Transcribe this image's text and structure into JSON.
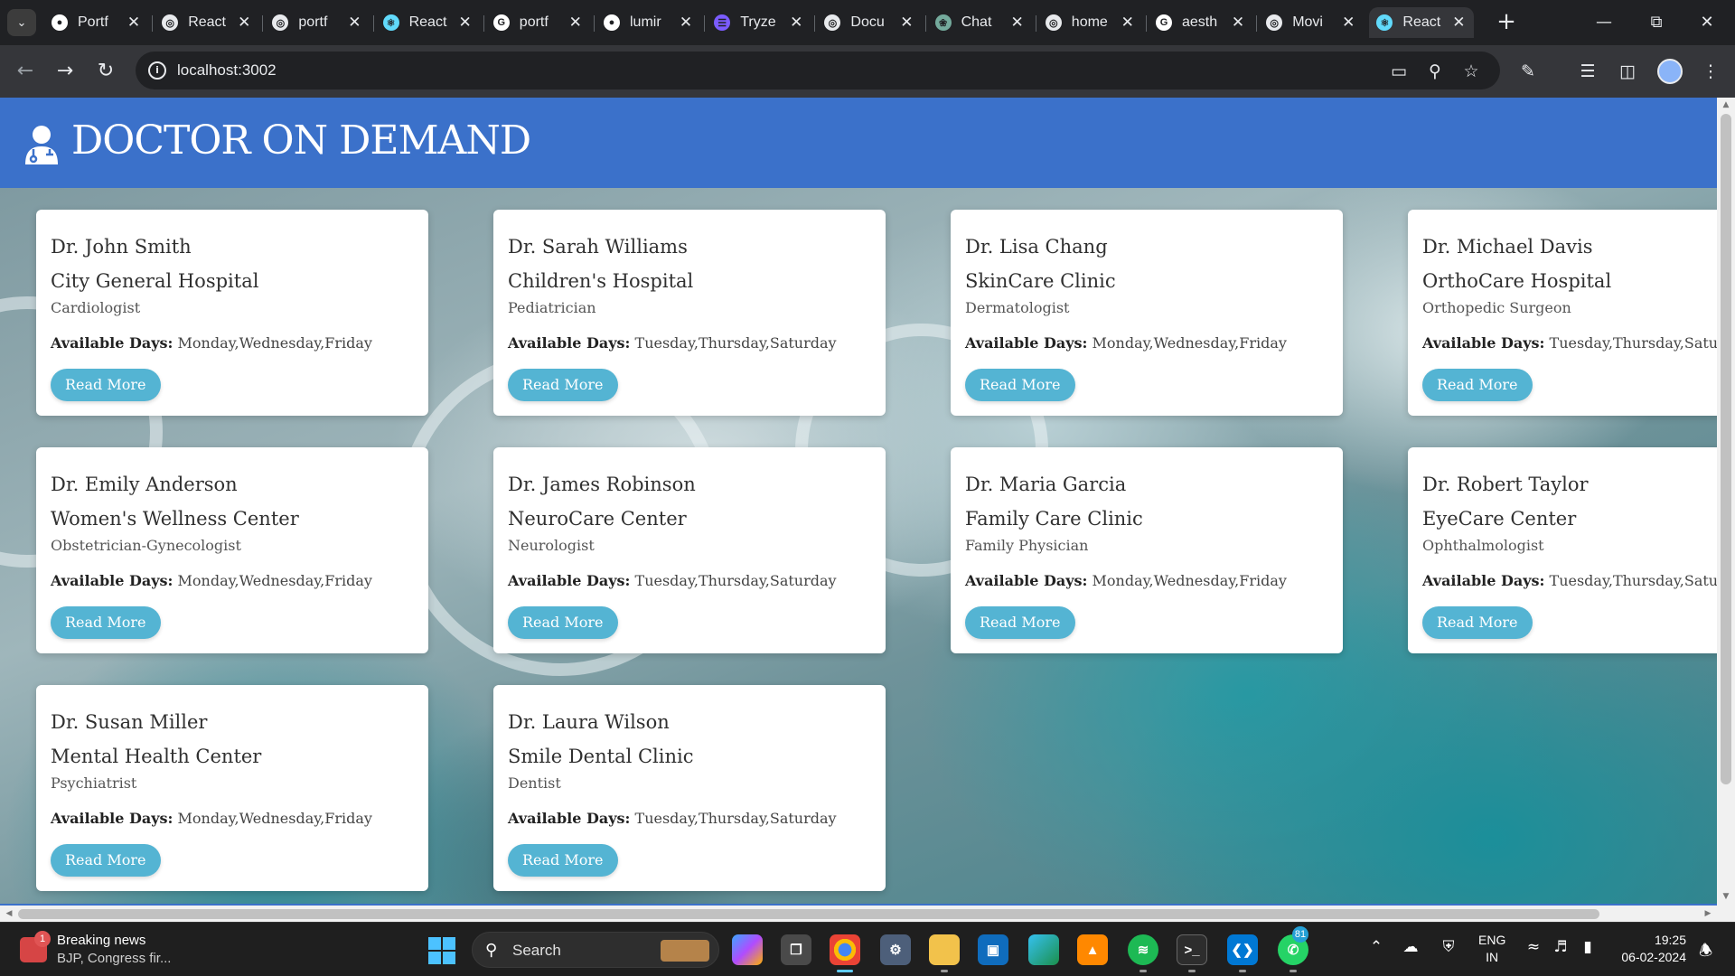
{
  "browser": {
    "tabs": [
      {
        "title": "Portf",
        "favicon": "github-icon",
        "color": "#ffffff",
        "active": false
      },
      {
        "title": "React",
        "favicon": "globe-icon",
        "color": "#e8eaed",
        "active": false
      },
      {
        "title": "portf",
        "favicon": "globe-icon",
        "color": "#e8eaed",
        "active": false
      },
      {
        "title": "React",
        "favicon": "react-icon",
        "color": "#61dafb",
        "active": false
      },
      {
        "title": "portf",
        "favicon": "google-icon",
        "color": "#ffffff",
        "active": false
      },
      {
        "title": "lumir",
        "favicon": "github-icon",
        "color": "#ffffff",
        "active": false
      },
      {
        "title": "Tryze",
        "favicon": "list-icon",
        "color": "#7b5cff",
        "active": false
      },
      {
        "title": "Docu",
        "favicon": "globe-icon",
        "color": "#e8eaed",
        "active": false
      },
      {
        "title": "Chat",
        "favicon": "chatgpt-icon",
        "color": "#74aa9c",
        "active": false
      },
      {
        "title": "home",
        "favicon": "globe-icon",
        "color": "#e8eaed",
        "active": false
      },
      {
        "title": "aesth",
        "favicon": "google-icon",
        "color": "#ffffff",
        "active": false
      },
      {
        "title": "Movi",
        "favicon": "globe-icon",
        "color": "#e8eaed",
        "active": false
      },
      {
        "title": "React",
        "favicon": "react-icon",
        "color": "#61dafb",
        "active": true
      }
    ],
    "url": "localhost:3002"
  },
  "site": {
    "title": "DOCTOR ON DEMAND",
    "logo_icon": "doctor-icon",
    "header_color": "#3b71ca",
    "button_color": "#54b4d3"
  },
  "days_label": "Available Days:",
  "doctors": [
    {
      "name": "Dr. John Smith",
      "hospital": "City General Hospital",
      "specialty": "Cardiologist",
      "days": "Monday,Wednesday,Friday",
      "button": "Read More"
    },
    {
      "name": "Dr. Sarah Williams",
      "hospital": "Children's Hospital",
      "specialty": "Pediatrician",
      "days": "Tuesday,Thursday,Saturday",
      "button": "Read More"
    },
    {
      "name": "Dr. Lisa Chang",
      "hospital": "SkinCare Clinic",
      "specialty": "Dermatologist",
      "days": "Monday,Wednesday,Friday",
      "button": "Read More"
    },
    {
      "name": "Dr. Michael Davis",
      "hospital": "OrthoCare Hospital",
      "specialty": "Orthopedic Surgeon",
      "days": "Tuesday,Thursday,Saturday",
      "button": "Read More"
    },
    {
      "name": "Dr. Emily Anderson",
      "hospital": "Women's Wellness Center",
      "specialty": "Obstetrician-Gynecologist",
      "days": "Monday,Wednesday,Friday",
      "button": "Read More"
    },
    {
      "name": "Dr. James Robinson",
      "hospital": "NeuroCare Center",
      "specialty": "Neurologist",
      "days": "Tuesday,Thursday,Saturday",
      "button": "Read More"
    },
    {
      "name": "Dr. Maria Garcia",
      "hospital": "Family Care Clinic",
      "specialty": "Family Physician",
      "days": "Monday,Wednesday,Friday",
      "button": "Read More"
    },
    {
      "name": "Dr. Robert Taylor",
      "hospital": "EyeCare Center",
      "specialty": "Ophthalmologist",
      "days": "Tuesday,Thursday,Saturday",
      "button": "Read More"
    },
    {
      "name": "Dr. Susan Miller",
      "hospital": "Mental Health Center",
      "specialty": "Psychiatrist",
      "days": "Monday,Wednesday,Friday",
      "button": "Read More"
    },
    {
      "name": "Dr. Laura Wilson",
      "hospital": "Smile Dental Clinic",
      "specialty": "Dentist",
      "days": "Tuesday,Thursday,Saturday",
      "button": "Read More"
    }
  ],
  "taskbar": {
    "news_title": "Breaking news",
    "news_sub": "BJP, Congress fir...",
    "news_badge": "1",
    "search_label": "Search",
    "whatsapp_badge": "81",
    "lang_top": "ENG",
    "lang_bottom": "IN",
    "time": "19:25",
    "date": "06-02-2024"
  }
}
